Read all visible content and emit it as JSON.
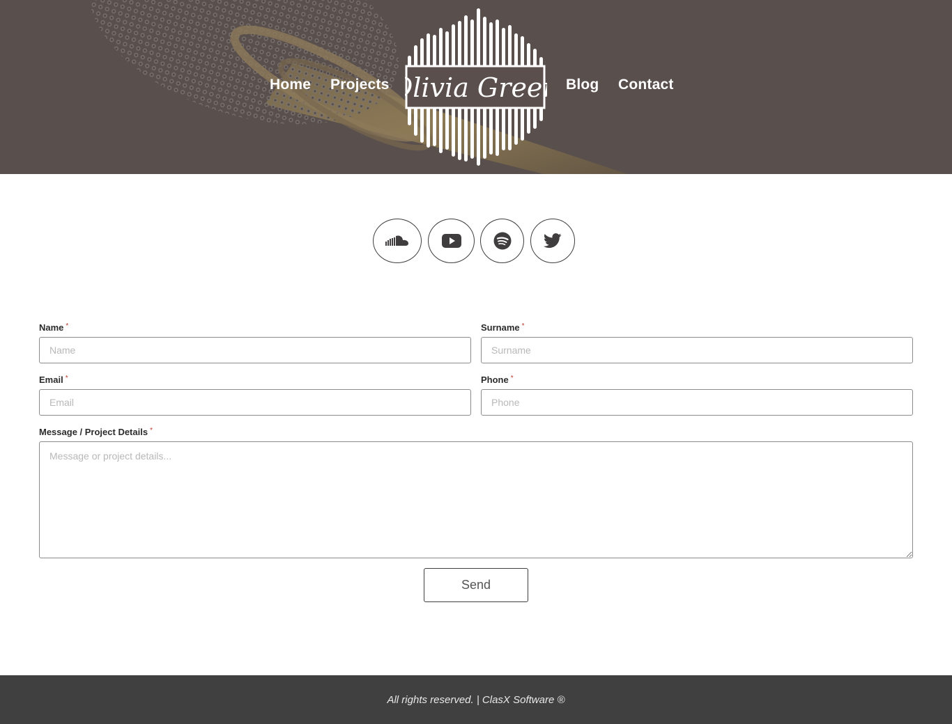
{
  "header": {
    "nav": {
      "home": "Home",
      "projects": "Projects",
      "blog": "Blog",
      "contact": "Contact"
    },
    "logo_text": "Olivia Green",
    "logo_icon": "soundwave-logo"
  },
  "social": [
    {
      "name": "soundcloud",
      "icon": "soundcloud-icon"
    },
    {
      "name": "youtube",
      "icon": "youtube-icon"
    },
    {
      "name": "spotify",
      "icon": "spotify-icon"
    },
    {
      "name": "twitter",
      "icon": "twitter-icon"
    }
  ],
  "form": {
    "required_mark": "*",
    "name": {
      "label": "Name",
      "placeholder": "Name",
      "value": ""
    },
    "surname": {
      "label": "Surname",
      "placeholder": "Surname",
      "value": ""
    },
    "email": {
      "label": "Email",
      "placeholder": "Email",
      "value": ""
    },
    "phone": {
      "label": "Phone",
      "placeholder": "Phone",
      "value": ""
    },
    "message": {
      "label": "Message / Project Details",
      "placeholder": "Message or project details...",
      "value": ""
    },
    "send_label": "Send"
  },
  "footer": {
    "text": "All rights reserved. | ClasX Software ®"
  },
  "colors": {
    "header_bg": "#5a4f4c",
    "footer_bg": "#414040",
    "required": "#c0392b",
    "border": "#8e8a8a"
  }
}
